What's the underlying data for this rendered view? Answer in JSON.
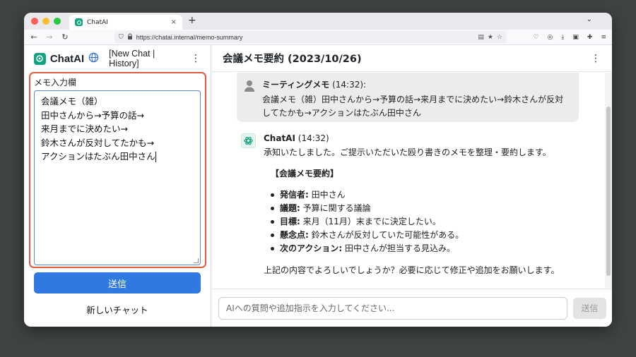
{
  "browser": {
    "tab_title": "ChatAI",
    "url": "https://chatai.internal/memo-summary",
    "traffic_colors": [
      "#ff5f57",
      "#febc2e",
      "#28c840"
    ]
  },
  "sidebar": {
    "brand": "ChatAI",
    "nav": "[New Chat | History]",
    "memo_label": "メモ入力欄",
    "memo_lines": [
      "会議メモ（雑）",
      "田中さんから→予算の話→",
      "来月までに決めたい→",
      "鈴木さんが反対してたかも→",
      "アクションはたぶん田中さん"
    ],
    "send_label": "送信",
    "new_chat_label": "新しいチャット"
  },
  "chat": {
    "title": "会議メモ要約 (2023/10/26)",
    "user_message": {
      "name": "ミーティングメモ",
      "time": "(14:32):",
      "text": "会議メモ（雑）田中さんから→予算の話→来月までに決めたい→鈴木さんが反対してたかも→アクションはたぶん田中さん"
    },
    "ai_message": {
      "name": "ChatAI",
      "time": "(14:32)",
      "intro": "承知いたしました。ご提示いただいた殴り書きのメモを整理・要約します。",
      "heading": "【会議メモ要約】",
      "items": [
        {
          "label": "発信者:",
          "text": " 田中さん"
        },
        {
          "label": "議題:",
          "text": " 予算に関する議論"
        },
        {
          "label": "目標:",
          "text": " 来月（11月）末までに決定したい。"
        },
        {
          "label": "懸念点:",
          "text": " 鈴木さんが反対していた可能性がある。"
        },
        {
          "label": "次のアクション:",
          "text": " 田中さんが担当する見込み。"
        }
      ],
      "closing": "上記の内容でよろしいでしょうか？必要に応じて修正や追加をお願いします。"
    },
    "input_placeholder": "AIへの質問や追加指示を入力してください...",
    "send_label": "送信"
  },
  "colors": {
    "accent_blue": "#2f79e0",
    "highlight_border": "#e05a3b",
    "brand_green": "#10a37f"
  }
}
